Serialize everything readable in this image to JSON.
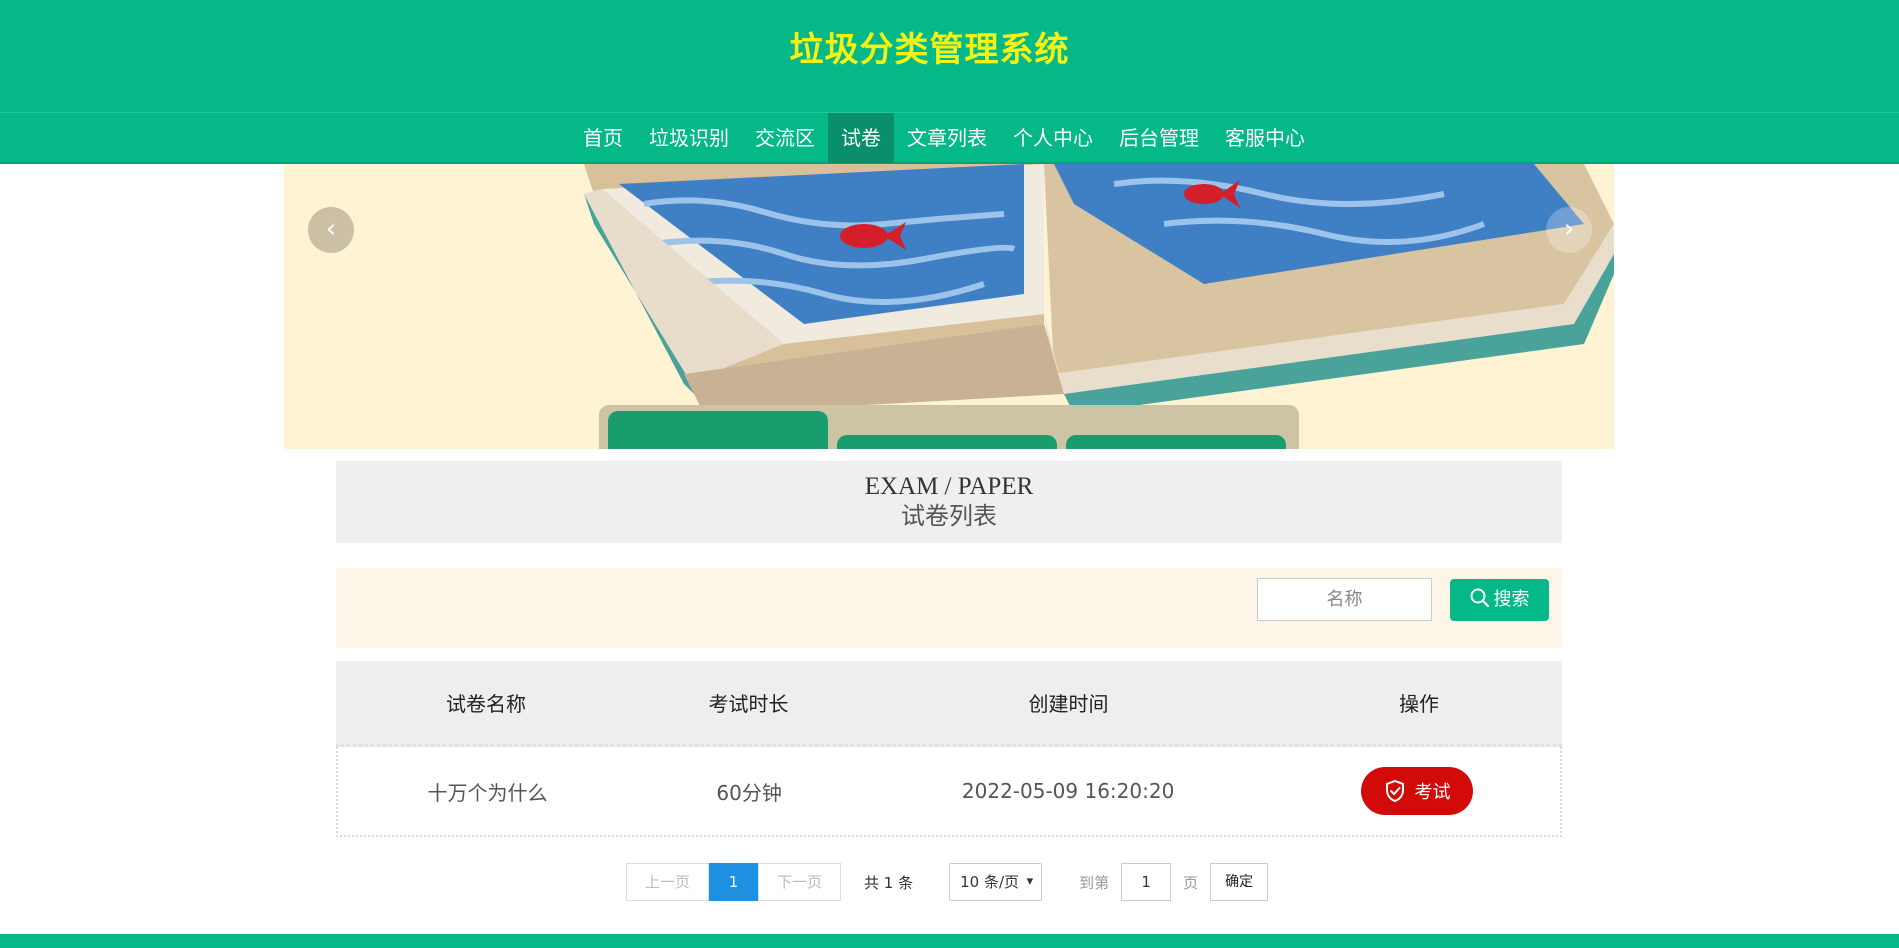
{
  "header": {
    "site_title": "垃圾分类管理系统"
  },
  "nav": {
    "items": [
      {
        "label": "首页"
      },
      {
        "label": "垃圾识别"
      },
      {
        "label": "交流区"
      },
      {
        "label": "试卷",
        "active": true
      },
      {
        "label": "文章列表"
      },
      {
        "label": "个人中心"
      },
      {
        "label": "后台管理"
      },
      {
        "label": "客服中心"
      }
    ]
  },
  "banner": {
    "prev_icon": "chevron-left-icon",
    "next_icon": "chevron-right-icon",
    "prev_glyph": "‹",
    "next_glyph": "›",
    "indicator_count": 3,
    "active_indicator": 1
  },
  "section": {
    "title_en": "EXAM / PAPER",
    "title_cn": "试卷列表"
  },
  "search": {
    "placeholder": "名称",
    "button_label": "搜索",
    "button_icon": "search-icon"
  },
  "table": {
    "headers": [
      "试卷名称",
      "考试时长",
      "创建时间",
      "操作"
    ],
    "rows": [
      {
        "name": "十万个为什么",
        "duration": "60分钟",
        "created": "2022-05-09 16:20:20",
        "action_label": "考试",
        "action_icon": "shield-check-icon"
      }
    ]
  },
  "pagination": {
    "prev_label": "上一页",
    "current_page": "1",
    "next_label": "下一页",
    "total_text": "共 1 条",
    "page_size_label": "10 条/页",
    "goto_label": "到第",
    "goto_value": "1",
    "page_suffix": "页",
    "confirm_label": "确定"
  },
  "colors": {
    "brand_green": "#04b887",
    "title_yellow": "#f4f214",
    "nav_active": "#0a8f6b",
    "exam_button_red": "#d20a0a",
    "page_active_blue": "#1e90e2"
  }
}
